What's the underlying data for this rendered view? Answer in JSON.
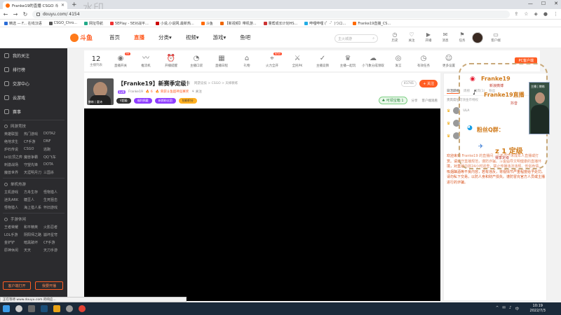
{
  "browser": {
    "tab_title": "Franke19的直播 CSGO 斗鱼 - 超...",
    "url": "douyu.com/ 4154",
    "new_tab": "+",
    "watermark_text": "水印"
  },
  "bookmarks": [
    {
      "label": "精选 — F... 在线汉语",
      "color": "#2a6cd6"
    },
    {
      "label": "CSGO_Chro...",
      "color": "#555"
    },
    {
      "label": "网址导航",
      "color": "#2a8"
    },
    {
      "label": "5EPlay - 5E对战平...",
      "color": "#e33"
    },
    {
      "label": "小说,小说网,最新热...",
      "color": "#c00"
    },
    {
      "label": "斗鱼",
      "color": "#ff6a00"
    },
    {
      "label": "【新视频】带机游...",
      "color": "#e60"
    },
    {
      "label": "量帮成长计划HS...",
      "color": "#c33"
    },
    {
      "label": "哔哩哔哩 (゜-゜)つロ...",
      "color": "#23ade5"
    },
    {
      "label": "Franke19直播_CS...",
      "color": "#ff6a00"
    }
  ],
  "header": {
    "logo_text": "斗鱼",
    "nav": [
      "首页",
      "直播",
      "分类▾",
      "视频▾",
      "游戏▾",
      "鱼吧"
    ],
    "active_nav": "直播",
    "search_placeholder": "主火城游",
    "icons": [
      {
        "label": "历史",
        "glyph": "◷"
      },
      {
        "label": "关注",
        "glyph": "♡"
      },
      {
        "label": "开播",
        "glyph": "▶"
      },
      {
        "label": "消息",
        "glyph": "✉"
      },
      {
        "label": "任务",
        "glyph": "⚑"
      },
      {
        "label": "下载",
        "glyph": "⇩"
      },
      {
        "label": "客户端",
        "glyph": "▭"
      }
    ]
  },
  "sidebar": {
    "top_items": [
      "我的关注",
      "排行榜",
      "交游中心",
      "云游戏",
      "赛事"
    ],
    "sections": [
      {
        "title": "网游竞技",
        "items": [
          "英雄联盟",
          "热门游戏",
          "DOTA2",
          "绝地求生",
          "CF手游",
          "DNF",
          "炉石传说",
          "CSGO",
          "逃跑",
          "lol云顶之弈",
          "魔兽争霸",
          "QQ飞车",
          "刺激战场",
          "守望先锋",
          "DOTA",
          "魔兽世界",
          "天涯明月刀",
          "三国杀"
        ]
      },
      {
        "title": "单机热游",
        "items": [
          "主机游戏",
          "方舟生存",
          "怪物猎人",
          "迷失ARK",
          "糖豆人",
          "生死狙击",
          "怪物猎人",
          "海上猎人系",
          "怀旧游戏"
        ]
      },
      {
        "title": "手游休闲",
        "items": [
          "王者荣耀",
          "和平精英",
          "火影忍者",
          "LOL手游",
          "阴阳师之路",
          "崩坏星穹",
          "金铲铲",
          "暗黑破坏",
          "CF手游",
          "原神休闲",
          "天天",
          "天刀手游"
        ]
      }
    ],
    "bottom_buttons": [
      "客户端打开",
      "我要开播"
    ]
  },
  "categories": {
    "count_value": "12",
    "count_label": "主播列表",
    "items": [
      {
        "label": "直播开关",
        "glyph": "◉",
        "badge": "99"
      },
      {
        "label": "推流机",
        "glyph": "〰",
        "badge": ""
      },
      {
        "label": "开播提醒",
        "glyph": "⏰",
        "badge": ""
      },
      {
        "label": "主播口袋",
        "glyph": "◔",
        "badge": ""
      },
      {
        "label": "直播日程",
        "glyph": "▦",
        "badge": ""
      },
      {
        "label": "礼物",
        "glyph": "⌂",
        "badge": ""
      },
      {
        "label": "火力全开",
        "glyph": "⌖",
        "badge": "NEW"
      },
      {
        "label": "全民PK",
        "glyph": "⚔",
        "badge": ""
      },
      {
        "label": "主播竞猜",
        "glyph": "✓",
        "badge": ""
      },
      {
        "label": "主播一起玩",
        "glyph": "♛",
        "badge": ""
      },
      {
        "label": "小飞象分成领取",
        "glyph": "☁",
        "badge": ""
      },
      {
        "label": "发言",
        "glyph": "◎",
        "badge": ""
      },
      {
        "label": "有效任务",
        "glyph": "◷",
        "badge": ""
      },
      {
        "label": "更多设置",
        "glyph": "☺",
        "badge": ""
      }
    ],
    "pc_badge": "PC客户端"
  },
  "room": {
    "title": "【Franke19】新赛季定级！",
    "meta": [
      "举报",
      "网游竞技 > CSGO > 天梯教练"
    ],
    "level": "Lv9",
    "anchor_name": "Franke19",
    "fire": "🔥 6",
    "hot_label": "🔥 荣获斗鱼超神竞赛奖",
    "follow_count": "⚘ 关注",
    "tags": [
      "V超级",
      "福利佩戴",
      "新颜粉丝团",
      "钻粉积分"
    ],
    "viewers": "41741",
    "follow_btn": "+ 关注",
    "treasure": "♣ 可领宝箱 1",
    "share": "分享",
    "client_view": "客户端观看",
    "avatar_caption": "教练 | 夏诗"
  },
  "chat": {
    "tabs": [
      "日活跃榜",
      "周榜",
      "贵宾(1)",
      "粉丝"
    ],
    "sub": "贵宾席位可领金币特权",
    "rows": [
      {
        "user": "ULA",
        "badge": "♛"
      },
      {
        "user": "",
        "badge": "♛"
      },
      {
        "user": "",
        "badge": "♛"
      }
    ],
    "notice": "欢迎来到 Franke19 的直播间，斗鱼严禁未成年人直播或打赏。请遵守直播规范，谨防诈骗。斗鱼倡导文明健康的直播环境，对直播内容24小时巡查，禁止传播违法违规、低俗色情、吸烟酗酒等不良内容，若有违反，将视情节严重程度给予处罚。请勿私下交易，以防人身和财产损失。谨防冒充官方人员或主播进行的诈骗。"
  },
  "overlay": {
    "weibo_text": "Franke19",
    "weibo_sub": "新浪微博",
    "douyin_text": "Franke19直播",
    "douyin_sub": "抖音",
    "qq_text": "粉丝Q群：",
    "rank_text": "z 1 定级",
    "rank_sub": "赛季定级",
    "cam_label": "主播 | 教练"
  },
  "status": {
    "statusbar": "正在等待 www.douyu.com 的响应..."
  },
  "taskbar": {
    "time": "10:19",
    "date": "2022/7/3",
    "tray": [
      "^",
      "✉",
      "♪",
      "中"
    ]
  }
}
